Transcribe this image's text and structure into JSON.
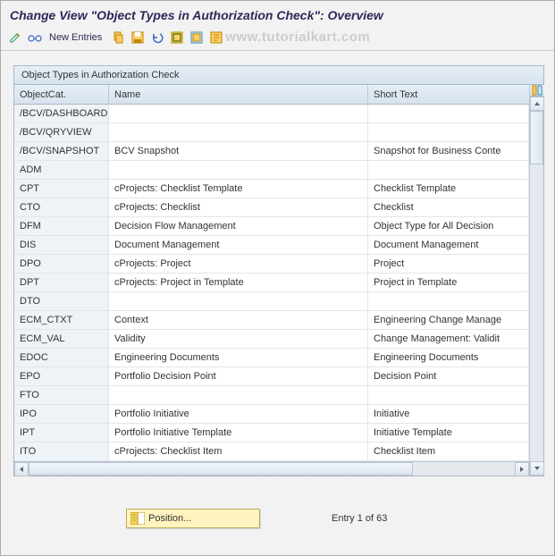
{
  "title": "Change View \"Object Types in Authorization Check\": Overview",
  "toolbar": {
    "new_entries_label": "New Entries"
  },
  "watermark": "www.tutorialkart.com",
  "table": {
    "caption": "Object Types in Authorization Check",
    "columns": {
      "cat": "ObjectCat.",
      "name": "Name",
      "short": "Short Text"
    },
    "rows": [
      {
        "cat": "/BCV/DASHBOARD",
        "name": "",
        "short": ""
      },
      {
        "cat": "/BCV/QRYVIEW",
        "name": "",
        "short": ""
      },
      {
        "cat": "/BCV/SNAPSHOT",
        "name": "BCV Snapshot",
        "short": "Snapshot for Business Conte"
      },
      {
        "cat": "ADM",
        "name": "",
        "short": ""
      },
      {
        "cat": "CPT",
        "name": "cProjects: Checklist Template",
        "short": "Checklist Template"
      },
      {
        "cat": "CTO",
        "name": "cProjects: Checklist",
        "short": "Checklist"
      },
      {
        "cat": "DFM",
        "name": "Decision Flow Management",
        "short": "Object Type for All Decision"
      },
      {
        "cat": "DIS",
        "name": "Document Management",
        "short": "Document Management"
      },
      {
        "cat": "DPO",
        "name": "cProjects: Project",
        "short": "Project"
      },
      {
        "cat": "DPT",
        "name": "cProjects: Project in Template",
        "short": "Project in Template"
      },
      {
        "cat": "DTO",
        "name": "",
        "short": ""
      },
      {
        "cat": "ECM_CTXT",
        "name": "Context",
        "short": "Engineering Change Manage"
      },
      {
        "cat": "ECM_VAL",
        "name": "Validity",
        "short": "Change Management: Validit"
      },
      {
        "cat": "EDOC",
        "name": "Engineering Documents",
        "short": "Engineering Documents"
      },
      {
        "cat": "EPO",
        "name": "Portfolio Decision Point",
        "short": "Decision Point"
      },
      {
        "cat": "FTO",
        "name": "",
        "short": ""
      },
      {
        "cat": "IPO",
        "name": "Portfolio Initiative",
        "short": "Initiative"
      },
      {
        "cat": "IPT",
        "name": "Portfolio Initiative Template",
        "short": "Initiative Template"
      },
      {
        "cat": "ITO",
        "name": "cProjects: Checklist Item",
        "short": "Checklist Item"
      }
    ]
  },
  "footer": {
    "position_label": "Position...",
    "entry_text": "Entry 1 of 63"
  }
}
